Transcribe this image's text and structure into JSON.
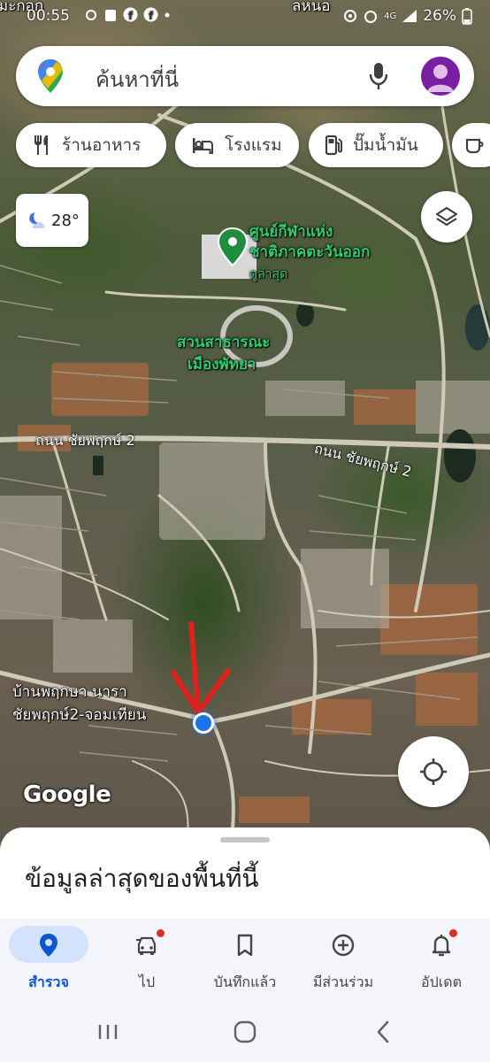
{
  "status_bar": {
    "time": "00:55",
    "network": "4G",
    "battery": "26%"
  },
  "search": {
    "placeholder": "ค้นหาที่นี่"
  },
  "chips": [
    {
      "label": "ร้านอาหาร",
      "icon": "restaurant-icon"
    },
    {
      "label": "โรงแรม",
      "icon": "hotel-icon"
    },
    {
      "label": "ปั๊มน้ำมัน",
      "icon": "gas-station-icon"
    },
    {
      "label": "",
      "icon": "coffee-icon"
    }
  ],
  "weather": {
    "temperature": "28°",
    "icon": "partly-cloudy-night-icon"
  },
  "map": {
    "labels": {
      "top_left_partial": "มะกอก",
      "top_right_partial": "ลหนอ",
      "landmark_line1": "ศูนย์กีฬาแห่ง",
      "landmark_line2": "ชาติภาคตะวันออก",
      "landmark_sub": "ดูล่าสุด",
      "park_line1": "สวนสาธารณะ",
      "park_line2": "เมืองพัทยา",
      "road_left": "ถนน ชัยพฤกษ์ 2",
      "road_right": "ถนน ชัยพฤกษ์ 2",
      "area_line1": "บ้านพฤกษา นารา",
      "area_line2": "ชัยพฤกษ์2-จอมเทียน"
    },
    "watermark": "Google",
    "colors": {
      "place_label": "#2ecc71",
      "location_dot": "#1a73e8",
      "annotation_arrow": "#e0201c"
    }
  },
  "sheet": {
    "title": "ข้อมูลล่าสุดของพื้นที่นี้"
  },
  "nav": {
    "items": [
      {
        "label": "สำรวจ",
        "icon": "explore-pin-icon",
        "active": true
      },
      {
        "label": "ไป",
        "icon": "car-icon",
        "badge": true
      },
      {
        "label": "บันทึกแล้ว",
        "icon": "bookmark-icon"
      },
      {
        "label": "มีส่วนร่วม",
        "icon": "add-circle-icon"
      },
      {
        "label": "อัปเดต",
        "icon": "bell-icon",
        "badge": true
      }
    ]
  },
  "accent_color": "#0b57d0"
}
